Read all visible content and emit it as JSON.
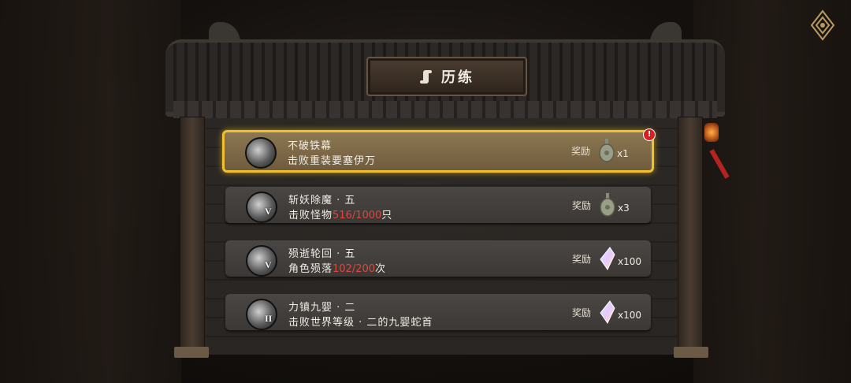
{
  "title": "历练",
  "colors": {
    "accent_gold": "#f0c030",
    "progress_red": "#e0463c"
  },
  "tasks": [
    {
      "name": "不破铁幕",
      "desc": "击败重装要塞伊万",
      "desc_prefix": "",
      "progress": "",
      "desc_suffix": "",
      "rank": "",
      "reward_label": "奖励",
      "reward_icon": "jade-token-icon",
      "reward_qty": "x1",
      "active": true,
      "alert": "!"
    },
    {
      "name": "斩妖除魔 · 五",
      "desc_prefix": "击败怪物",
      "progress": "516/1000",
      "desc_suffix": "只",
      "rank": "V",
      "reward_label": "奖励",
      "reward_icon": "jade-token-icon",
      "reward_qty": "x3",
      "active": false
    },
    {
      "name": "殒逝轮回 · 五",
      "desc_prefix": "角色殒落",
      "progress": "102/200",
      "desc_suffix": "次",
      "rank": "V",
      "reward_label": "奖励",
      "reward_icon": "crystal-icon",
      "reward_qty": "x100",
      "active": false
    },
    {
      "name": "力镇九婴 · 二",
      "desc": "击败世界等级 · 二的九婴蛇首",
      "desc_prefix": "",
      "progress": "",
      "desc_suffix": "",
      "rank": "II",
      "reward_label": "奖励",
      "reward_icon": "crystal-icon",
      "reward_qty": "x100",
      "active": false
    }
  ]
}
